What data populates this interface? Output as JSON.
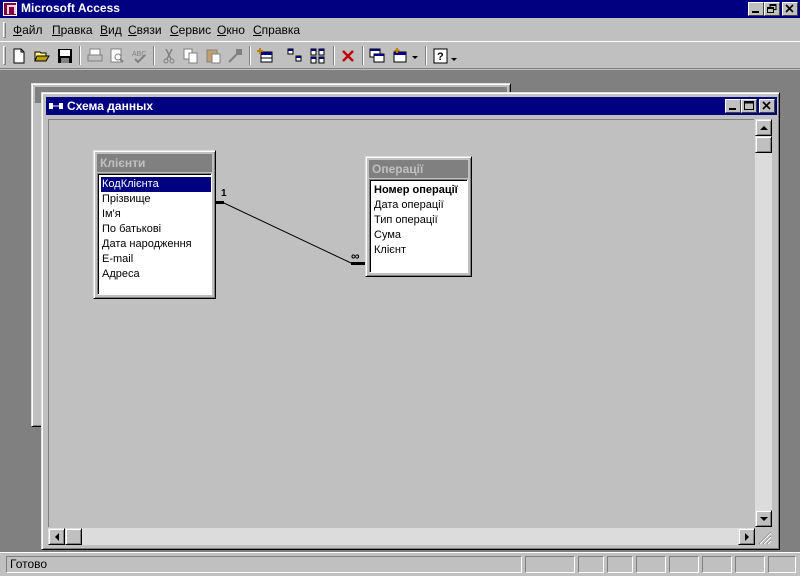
{
  "app": {
    "title": "Microsoft Access"
  },
  "menu": {
    "items": [
      "Файл",
      "Правка",
      "Вид",
      "Связи",
      "Сервис",
      "Окно",
      "Справка"
    ]
  },
  "toolbar": {
    "buttons": [
      "new-icon",
      "open-icon",
      "save-icon",
      "print-icon",
      "print-preview-icon",
      "spelling-icon",
      "cut-icon",
      "copy-icon",
      "paste-icon",
      "format-painter-icon",
      "show-table-icon",
      "show-direct-icon",
      "show-all-icon",
      "delete-icon",
      "new-window-icon",
      "new-object-icon",
      "help-icon"
    ]
  },
  "schema_window": {
    "title": "Схема данных"
  },
  "tables": {
    "clients": {
      "title": "Клієнти",
      "fields": [
        "КодКлієнта",
        "Прізвище",
        "Ім'я",
        "По батькові",
        "Дата народження",
        "E-mail",
        "Адреса"
      ],
      "selected": 0
    },
    "operations": {
      "title": "Операції",
      "fields": [
        "Номер операції",
        "Дата операції",
        "Тип операції",
        "Сума",
        "Клієнт"
      ],
      "primary_key": 0
    }
  },
  "relationship": {
    "one_label": "1",
    "many_label": "∞"
  },
  "status": {
    "text": "Готово"
  },
  "colors": {
    "title_active": "#000080",
    "title_inactive": "#808080",
    "face": "#c0c0c0",
    "mdi_background": "#808080"
  }
}
